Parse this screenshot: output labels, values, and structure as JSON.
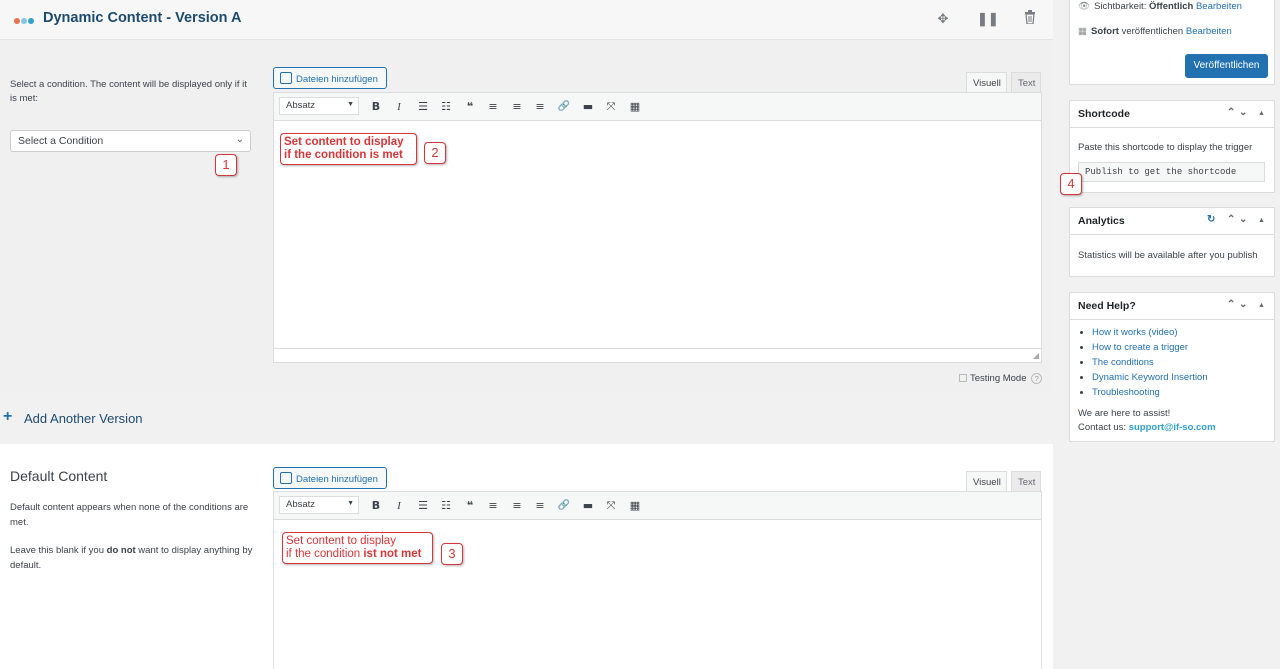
{
  "version": {
    "title": "Dynamic Content - Version A",
    "dot_colors": [
      "#e8734d",
      "#7fc6ea",
      "#2ea2cc"
    ],
    "condition_label": "Select a condition. The content will be displayed only if it is met:",
    "condition_select": "Select a Condition",
    "add_media": "Dateien hinzufügen",
    "tab_visual": "Visuell",
    "tab_text": "Text",
    "format": "Absatz",
    "content_line1": "Set content to display",
    "content_line2": "if the condition is met",
    "testing_mode": "Testing Mode",
    "testing_mode_help": "?"
  },
  "toolbar": {
    "bold": "B",
    "italic": "I",
    "bullet_list": "☰",
    "numbered_list": "☷",
    "quote": "❝",
    "align_left": "≡",
    "align_center": "≡",
    "align_right": "≡",
    "link": "🔗",
    "more": "▬",
    "fullscreen": "⤧",
    "kitchen_sink": "▦"
  },
  "add_version": {
    "plus": "+",
    "label": "Add Another Version"
  },
  "default_content": {
    "title": "Default Content",
    "desc1": "Default content appears when none of the conditions are met.",
    "desc2_pre": "Leave this blank if you ",
    "desc2_bold": "do not",
    "desc2_post": " want to display anything by default.",
    "add_media": "Dateien hinzufügen",
    "tab_visual": "Visuell",
    "tab_text": "Text",
    "format": "Absatz",
    "content_line1": "Set content to display",
    "content_line2_pre": "if the condition ",
    "content_line2_bold": "ist not met"
  },
  "markers": [
    "1",
    "2",
    "3",
    "4"
  ],
  "publish": {
    "visibility_label": "Sichtbarkeit: ",
    "visibility_value": "Öffentlich",
    "visibility_edit": "Bearbeiten",
    "schedule_bold": "Sofort",
    "schedule_text": " veröffentlichen",
    "schedule_edit": "Bearbeiten",
    "publish_button": "Veröffentlichen"
  },
  "shortcode": {
    "title": "Shortcode",
    "desc": "Paste this shortcode to display the trigger",
    "value": "Publish to get the shortcode"
  },
  "analytics": {
    "title": "Analytics",
    "desc": "Statistics will be available after you publish"
  },
  "help": {
    "title": "Need Help?",
    "links": [
      "How it works (video)",
      "How to create a trigger",
      "The conditions",
      "Dynamic Keyword Insertion",
      "Troubleshooting"
    ],
    "assist": "We are here to assist!",
    "contact_label": "Contact us: ",
    "contact_email": "support@if-so.com"
  },
  "colors": {
    "accent": "#2271b1",
    "marker": "#d63638",
    "title": "#1d4b6e"
  }
}
